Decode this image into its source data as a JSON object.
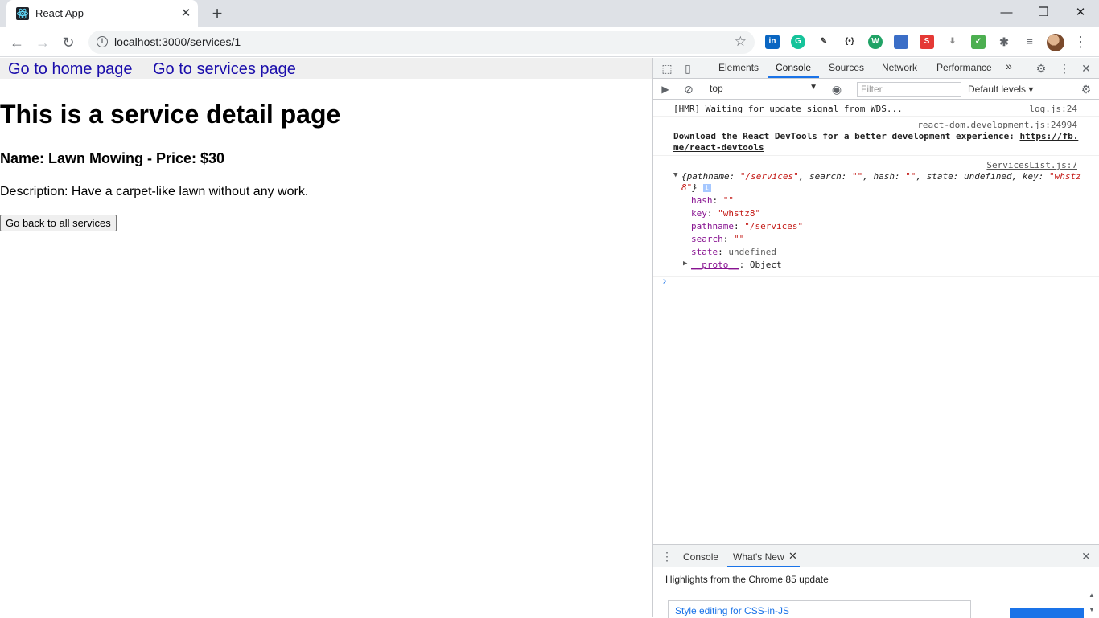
{
  "browser": {
    "tab_title": "React App",
    "tab_close": "✕",
    "new_tab": "+",
    "window_controls": {
      "minimize": "—",
      "restore": "❐",
      "close": "✕"
    },
    "back": "←",
    "forward": "→",
    "reload": "↻",
    "url": "localhost:3000/services/1",
    "star": "☆",
    "kebab": "⋮"
  },
  "page": {
    "links": [
      "Go to home page",
      "Go to services page"
    ],
    "heading": "This is a service detail page",
    "subheading": "Name: Lawn Mowing - Price: $30",
    "description": "Description: Have a carpet-like lawn without any work.",
    "back_button": "Go back to all services"
  },
  "devtools": {
    "tabs": [
      "Elements",
      "Console",
      "Sources",
      "Network",
      "Performance"
    ],
    "more_tabs": "»",
    "context": "top",
    "filter_placeholder": "Filter",
    "levels": "Default levels",
    "messages": {
      "hmr_text": "[HMR] Waiting for update signal from WDS...",
      "hmr_src": "log.js:24",
      "react_src": "react-dom.development.js:24994",
      "react_text_1": "Download the React DevTools for a better development experience: ",
      "react_link_1": "https://fb.",
      "react_link_2": "me/react-devtools",
      "services_src": "ServicesList.js:7",
      "obj_summary_1": "{pathname: ",
      "obj_pathname": "\"/services\"",
      "obj_summary_2": ", search: ",
      "obj_search": "\"\"",
      "obj_summary_3": ", hash: ",
      "obj_hash": "\"\"",
      "obj_summary_4": ", state: undefined, key: ",
      "obj_key_a": "\"whstz",
      "obj_key_b": "8\"",
      "obj_close": "}",
      "props": [
        {
          "key": "hash",
          "value": "\"\""
        },
        {
          "key": "key",
          "value": "\"whstz8\""
        },
        {
          "key": "pathname",
          "value": "\"/services\""
        },
        {
          "key": "search",
          "value": "\"\""
        },
        {
          "key": "state",
          "value": "undefined"
        },
        {
          "key": "__proto__",
          "value": "Object"
        }
      ]
    },
    "prompt": "›",
    "drawer": {
      "tabs": [
        "Console",
        "What's New"
      ],
      "highlights": "Highlights from the Chrome 85 update",
      "card_title": "Style editing for CSS-in-JS"
    }
  }
}
